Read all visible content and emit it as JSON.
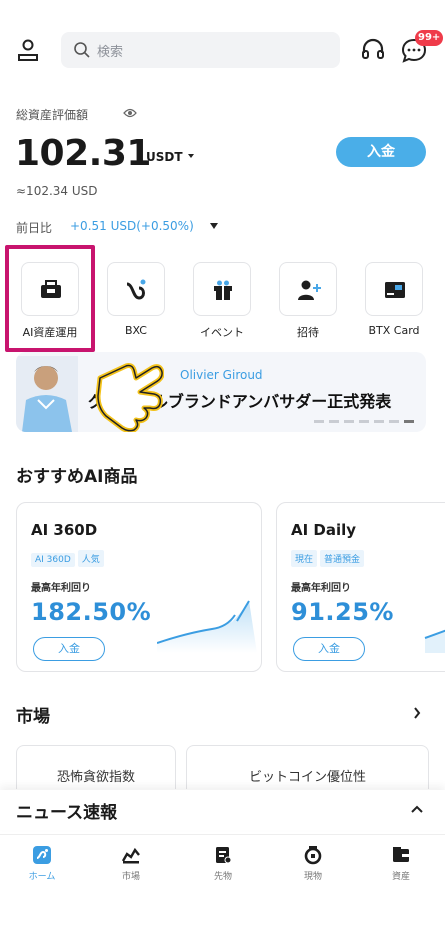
{
  "topbar": {
    "search_placeholder": "検索",
    "notification_badge": "99+"
  },
  "asset": {
    "label": "総資産評価額",
    "balance": "102.31",
    "unit": "USDT",
    "usd_equivalent": "≈102.34 USD",
    "change_label": "前日比",
    "change_value": "+0.51 USD(+0.50%)",
    "deposit_label": "入金"
  },
  "shortcuts": [
    {
      "label": "AI資産運用",
      "icon": "ai-asset-icon"
    },
    {
      "label": "BXC",
      "icon": "bxc-icon"
    },
    {
      "label": "イベント",
      "icon": "gift-icon"
    },
    {
      "label": "招待",
      "icon": "invite-icon"
    },
    {
      "label": "BTX Card",
      "icon": "card-icon"
    }
  ],
  "banner": {
    "subtitle": "Olivier Giroud",
    "title": "グローバルブランドアンバサダー正式発表"
  },
  "recommended": {
    "title": "おすすめAI商品",
    "cards": [
      {
        "name": "AI 360D",
        "tags": [
          "AI 360D",
          "人気"
        ],
        "yield_label": "最高年利回り",
        "yield": "182.50%",
        "button": "入金"
      },
      {
        "name": "AI Daily",
        "tags": [
          "現在",
          "普通預金"
        ],
        "yield_label": "最高年利回り",
        "yield": "91.25%",
        "button": "入金"
      }
    ]
  },
  "market": {
    "title": "市場",
    "tabs": [
      "恐怖貪欲指数",
      "ビットコイン優位性"
    ]
  },
  "news": {
    "title": "ニュース速報"
  },
  "nav": [
    {
      "label": "ホーム",
      "icon": "home-icon",
      "active": true
    },
    {
      "label": "市場",
      "icon": "market-icon",
      "active": false
    },
    {
      "label": "先物",
      "icon": "futures-icon",
      "active": false
    },
    {
      "label": "現物",
      "icon": "spot-icon",
      "active": false
    },
    {
      "label": "資産",
      "icon": "assets-icon",
      "active": false
    }
  ],
  "colors": {
    "accent": "#3b9de2",
    "highlight": "#c8146e",
    "badge": "#ef3b4a"
  }
}
